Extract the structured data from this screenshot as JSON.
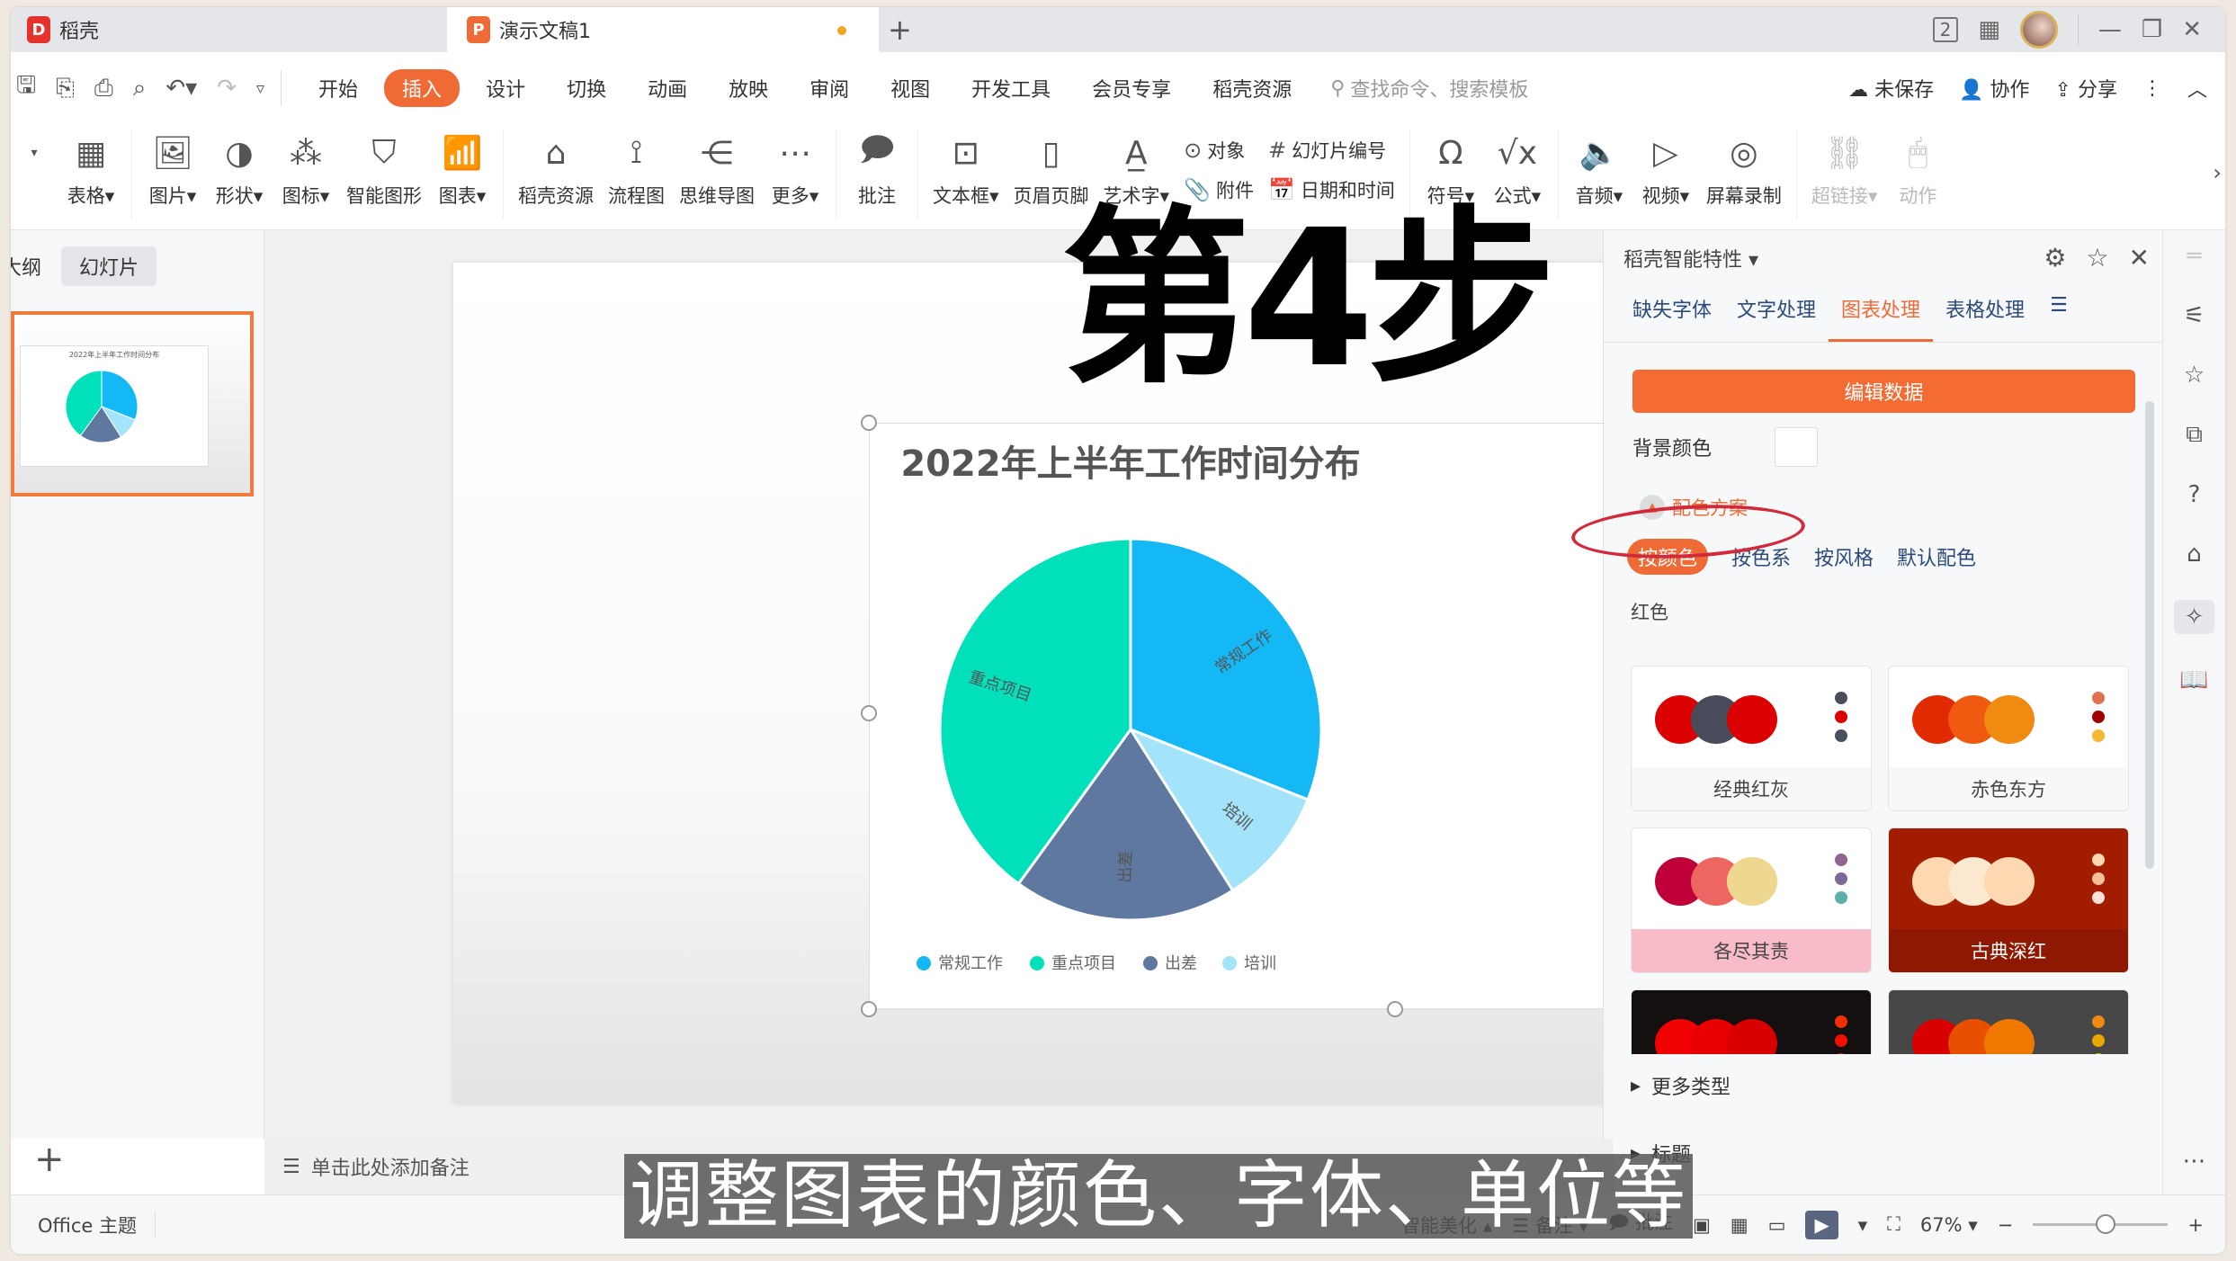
{
  "tabs": {
    "home": {
      "label": "稻壳",
      "icon": "daoke-logo-icon"
    },
    "doc": {
      "label": "演示文稿1",
      "icon": "presentation-logo-icon",
      "unsaved_dot_color": "#f5a623"
    },
    "new_tab": "+"
  },
  "window_controls": {
    "badge": "2",
    "minimize": "—",
    "restore": "❐",
    "close": "✕"
  },
  "quick_access": [
    "save",
    "save-as",
    "print",
    "print-preview",
    "undo",
    "redo",
    "customize"
  ],
  "menu": {
    "items": [
      "开始",
      "插入",
      "设计",
      "切换",
      "动画",
      "放映",
      "审阅",
      "视图",
      "开发工具",
      "会员专享",
      "稻壳资源"
    ],
    "active": "插入",
    "search_placeholder": "查找命令、搜索模板",
    "right": {
      "unsaved": "未保存",
      "collab": "协作",
      "share": "分享"
    }
  },
  "ribbon": {
    "groups": [
      {
        "label": "表格",
        "dropdown": true,
        "icon": "table-icon"
      },
      {
        "label": "图片",
        "dropdown": true,
        "icon": "picture-icon"
      },
      {
        "label": "形状",
        "dropdown": true,
        "icon": "shape-icon"
      },
      {
        "label": "图标",
        "dropdown": true,
        "icon": "icons-icon"
      },
      {
        "label": "智能图形",
        "dropdown": false,
        "icon": "smartart-icon"
      },
      {
        "label": "图表",
        "dropdown": true,
        "icon": "chart-icon"
      },
      {
        "label": "稻壳资源",
        "dropdown": false,
        "icon": "resource-icon"
      },
      {
        "label": "流程图",
        "dropdown": false,
        "icon": "flowchart-icon"
      },
      {
        "label": "思维导图",
        "dropdown": false,
        "icon": "mindmap-icon"
      },
      {
        "label": "更多",
        "dropdown": true,
        "icon": "more-icon"
      },
      {
        "label": "批注",
        "dropdown": false,
        "icon": "comment-icon"
      },
      {
        "label": "文本框",
        "dropdown": true,
        "icon": "textbox-icon"
      },
      {
        "label": "页眉页脚",
        "dropdown": false,
        "icon": "header-footer-icon"
      },
      {
        "label": "艺术字",
        "dropdown": true,
        "icon": "wordart-icon"
      }
    ],
    "small": [
      {
        "label": "对象",
        "icon": "object-icon"
      },
      {
        "label": "附件",
        "icon": "attachment-icon"
      },
      {
        "label": "幻灯片编号",
        "icon": "slide-number-icon"
      },
      {
        "label": "日期和时间",
        "icon": "datetime-icon"
      }
    ],
    "groups2": [
      {
        "label": "符号",
        "dropdown": true,
        "icon": "symbol-icon"
      },
      {
        "label": "公式",
        "dropdown": true,
        "icon": "formula-icon"
      },
      {
        "label": "音频",
        "dropdown": true,
        "icon": "audio-icon"
      },
      {
        "label": "视频",
        "dropdown": true,
        "icon": "video-icon"
      },
      {
        "label": "屏幕录制",
        "dropdown": false,
        "icon": "screen-record-icon"
      },
      {
        "label": "超链接",
        "dropdown": true,
        "icon": "hyperlink-icon",
        "disabled": true
      },
      {
        "label": "动作",
        "dropdown": false,
        "icon": "action-icon",
        "disabled": true
      }
    ]
  },
  "left_panel": {
    "tabs": [
      "大纲",
      "幻灯片"
    ],
    "active_tab": "幻灯片",
    "add_label": "+"
  },
  "overlay_step": "第4步",
  "notes_placeholder": "单击此处添加备注",
  "subtitle": "调整图表的颜色、字体、单位等",
  "status": {
    "theme": "Office 主题",
    "beautify": "智能美化",
    "notes": "备注",
    "comment": "批注",
    "zoom": "67%"
  },
  "chart_data": {
    "type": "pie",
    "title": "2022年上半年工作时间分布",
    "categories": [
      "常规工作",
      "培训",
      "出差",
      "重点项目"
    ],
    "values": [
      31,
      10,
      19,
      40
    ],
    "colors": [
      "#14b8f5",
      "#a3e4fb",
      "#5f78a0",
      "#00e0bb"
    ],
    "legend": [
      "常规工作",
      "重点项目",
      "出差",
      "培训"
    ],
    "legend_colors": [
      "#14b8f5",
      "#00e0bb",
      "#5f78a0",
      "#a3e4fb"
    ],
    "legend_position": "bottom",
    "data_labels": "category-name"
  },
  "right_panel": {
    "title": "稻壳智能特性",
    "tabs": [
      "缺失字体",
      "文字处理",
      "图表处理",
      "表格处理"
    ],
    "active_tab": "图表处理",
    "edit_data": "编辑数据",
    "bg_color_label": "背景颜色",
    "scheme_label": "配色方案",
    "filters": [
      "按颜色",
      "按色系",
      "按风格",
      "默认配色"
    ],
    "active_filter": "按颜色",
    "color_group": "红色",
    "schemes": [
      {
        "name": "经典红灰",
        "bg": "#ffffff",
        "label_bg": "#f7f8fa",
        "label_color": "#444",
        "circles": [
          "#dd0000",
          "#474b5a",
          "#dd0000"
        ],
        "dots": [
          "#4a4f5e",
          "#dd0000",
          "#4a4f5e"
        ]
      },
      {
        "name": "赤色东方",
        "bg": "#ffffff",
        "label_bg": "#f7f8fa",
        "label_color": "#444",
        "circles": [
          "#e02a00",
          "#f05a10",
          "#f08a10"
        ],
        "dots": [
          "#e07050",
          "#a00000",
          "#f5b830"
        ]
      },
      {
        "name": "各尽其责",
        "bg": "#ffffff",
        "label_bg": "#f7bcc8",
        "label_color": "#444",
        "circles": [
          "#c00038",
          "#ee6662",
          "#eed890"
        ],
        "dots": [
          "#8e6690",
          "#7a6a98",
          "#5cb0a8"
        ]
      },
      {
        "name": "古典深红",
        "bg": "#a21c00",
        "label_bg": "#8e1800",
        "label_color": "#ffffff",
        "circles": [
          "#fdd8b0",
          "#fde8d0",
          "#fdd8b0"
        ],
        "dots": [
          "#fdd8b0",
          "#f5c098",
          "#fde0d8"
        ]
      },
      {
        "name": "",
        "bg": "#141010",
        "label_bg": "#141010",
        "label_color": "#fff",
        "circles": [
          "#f00000",
          "#e80000",
          "#d80000"
        ],
        "dots": [
          "#f03000",
          "#f01000",
          "#e03000"
        ]
      },
      {
        "name": "",
        "bg": "#474747",
        "label_bg": "#474747",
        "label_color": "#fff",
        "circles": [
          "#d80000",
          "#e85000",
          "#f07800"
        ],
        "dots": [
          "#f08a10",
          "#e8a800",
          "#e8c800"
        ]
      }
    ],
    "more_types": "更多类型",
    "title_section": "标题"
  },
  "rail_icons": [
    "sliders-icon",
    "star-icon",
    "transform-icon",
    "help-icon",
    "resource-icon",
    "smart-icon",
    "book-icon"
  ]
}
